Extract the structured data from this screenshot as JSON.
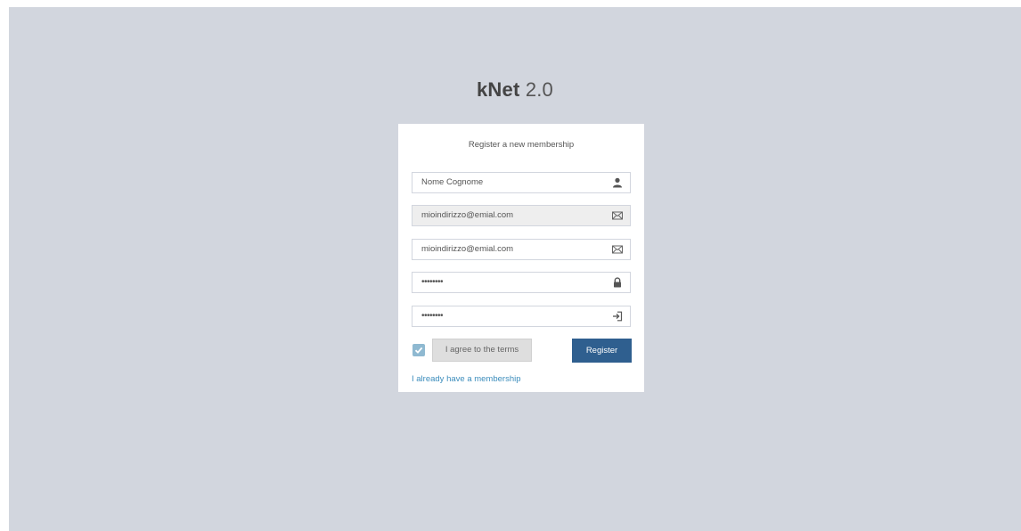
{
  "logo": {
    "name": "kNet",
    "version": "2.0"
  },
  "form": {
    "message": "Register a new membership",
    "fields": [
      {
        "value": "Nome Cognome",
        "icon": "user-icon"
      },
      {
        "value": "mioindirizzo@emial.com",
        "icon": "envelope-icon"
      },
      {
        "value": "mioindirizzo@emial.com",
        "icon": "envelope-icon"
      },
      {
        "value": "••••••••",
        "icon": "lock-icon"
      },
      {
        "value": "••••••••",
        "icon": "log-in-icon"
      }
    ],
    "terms_label": "I agree to the terms",
    "terms_checked": true,
    "register_label": "Register",
    "login_link": "I already have a membership"
  },
  "colors": {
    "background": "#d2d6de",
    "primary_button": "#2f5f8f",
    "link": "#3c8dbc",
    "checkbox": "#8fb9d1"
  }
}
